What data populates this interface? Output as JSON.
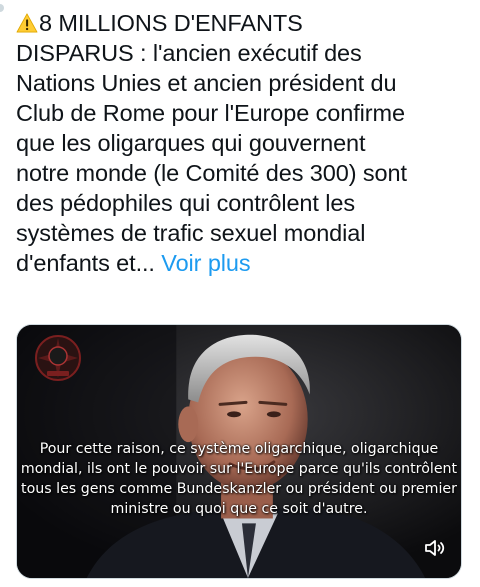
{
  "tweet": {
    "warning_icon": "warning-icon",
    "text": "8 MILLIONS D'ENFANTS\nDISPARUS : l'ancien exécutif des\nNations Unies et ancien président du\nClub de Rome pour l'Europe confirme\nque les oligarques qui gouvernent\nnotre monde (le Comité des 300) sont\ndes pédophiles qui contrôlent les\nsystèmes de trafic sexuel mondial\nd'enfants et...",
    "see_more_label": "Voir plus"
  },
  "video": {
    "channel_logo_icon": "channel-logo-icon",
    "subtitle_lines": [
      "Pour cette raison, ce système oligarchique, oligarchique",
      "mondial, ils ont le pouvoir sur l'Europe parce qu'ils contrôlent",
      "tous les gens comme Bundeskanzler ou président ou premier",
      "ministre ou quoi que ce soit d'autre."
    ],
    "mute_icon": "speaker-muted-icon"
  },
  "colors": {
    "link": "#1d9bf0",
    "text": "#0f1419",
    "warning": "#ffcc33"
  }
}
